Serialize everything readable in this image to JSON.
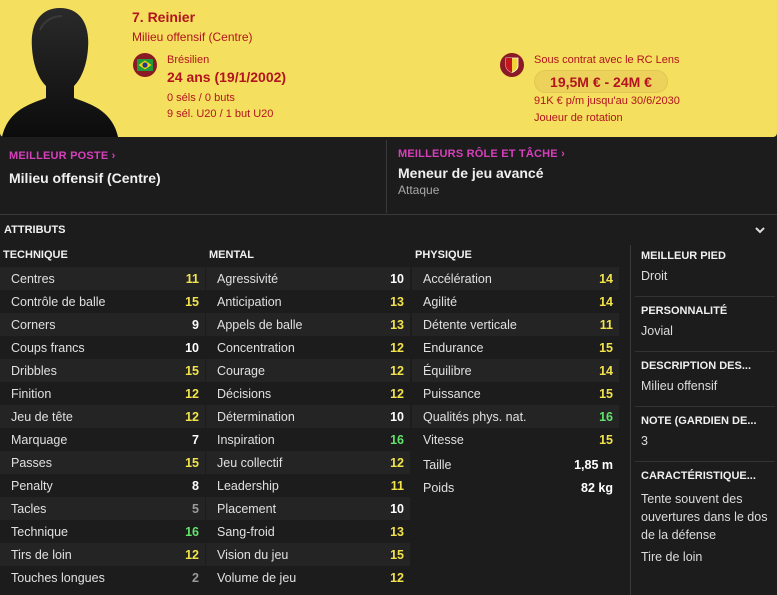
{
  "player": {
    "name": "7. Reinier",
    "position": "Milieu offensif (Centre)",
    "nationality": "Brésilien",
    "age": "24 ans (19/1/2002)",
    "stats_line1": "0 séls / 0 buts",
    "stats_line2": "9 sél. U20 / 1 but U20",
    "contract": "Sous contrat avec le RC Lens",
    "value": "19,5M € - 24M €",
    "wage": "91K € p/m jusqu'au 30/6/2030",
    "squad_status": "Joueur de rotation"
  },
  "best": {
    "position_label": "MEILLEUR POSTE",
    "position_value": "Milieu offensif (Centre)",
    "role_label": "MEILLEURS RÔLE ET TÂCHE",
    "role_value": "Meneur de jeu avancé",
    "role_duty": "Attaque"
  },
  "attributes_title": "ATTRIBUTS",
  "technical": {
    "title": "TECHNIQUE",
    "rows": [
      {
        "label": "Centres",
        "value": "11",
        "color": "yellow"
      },
      {
        "label": "Contrôle de balle",
        "value": "15",
        "color": "yellow"
      },
      {
        "label": "Corners",
        "value": "9",
        "color": "white"
      },
      {
        "label": "Coups francs",
        "value": "10",
        "color": "white"
      },
      {
        "label": "Dribbles",
        "value": "15",
        "color": "yellow"
      },
      {
        "label": "Finition",
        "value": "12",
        "color": "yellow"
      },
      {
        "label": "Jeu de tête",
        "value": "12",
        "color": "yellow"
      },
      {
        "label": "Marquage",
        "value": "7",
        "color": "white"
      },
      {
        "label": "Passes",
        "value": "15",
        "color": "yellow"
      },
      {
        "label": "Penalty",
        "value": "8",
        "color": "white"
      },
      {
        "label": "Tacles",
        "value": "5",
        "color": "grey"
      },
      {
        "label": "Technique",
        "value": "16",
        "color": "green"
      },
      {
        "label": "Tirs de loin",
        "value": "12",
        "color": "yellow"
      },
      {
        "label": "Touches longues",
        "value": "2",
        "color": "grey"
      }
    ]
  },
  "mental": {
    "title": "MENTAL",
    "rows": [
      {
        "label": "Agressivité",
        "value": "10",
        "color": "white"
      },
      {
        "label": "Anticipation",
        "value": "13",
        "color": "yellow"
      },
      {
        "label": "Appels de balle",
        "value": "13",
        "color": "yellow"
      },
      {
        "label": "Concentration",
        "value": "12",
        "color": "yellow"
      },
      {
        "label": "Courage",
        "value": "12",
        "color": "yellow"
      },
      {
        "label": "Décisions",
        "value": "12",
        "color": "yellow"
      },
      {
        "label": "Détermination",
        "value": "10",
        "color": "white"
      },
      {
        "label": "Inspiration",
        "value": "16",
        "color": "green"
      },
      {
        "label": "Jeu collectif",
        "value": "12",
        "color": "yellow"
      },
      {
        "label": "Leadership",
        "value": "11",
        "color": "yellow"
      },
      {
        "label": "Placement",
        "value": "10",
        "color": "white"
      },
      {
        "label": "Sang-froid",
        "value": "13",
        "color": "yellow"
      },
      {
        "label": "Vision du jeu",
        "value": "15",
        "color": "yellow"
      },
      {
        "label": "Volume de jeu",
        "value": "12",
        "color": "yellow"
      }
    ]
  },
  "physical": {
    "title": "PHYSIQUE",
    "rows": [
      {
        "label": "Accélération",
        "value": "14",
        "color": "yellow"
      },
      {
        "label": "Agilité",
        "value": "14",
        "color": "yellow"
      },
      {
        "label": "Détente verticale",
        "value": "11",
        "color": "yellow"
      },
      {
        "label": "Endurance",
        "value": "15",
        "color": "yellow"
      },
      {
        "label": "Équilibre",
        "value": "14",
        "color": "yellow"
      },
      {
        "label": "Puissance",
        "value": "15",
        "color": "yellow"
      },
      {
        "label": "Qualités phys. nat.",
        "value": "16",
        "color": "green"
      },
      {
        "label": "Vitesse",
        "value": "15",
        "color": "yellow"
      }
    ],
    "extra": [
      {
        "label": "Taille",
        "value": "1,85 m"
      },
      {
        "label": "Poids",
        "value": "82 kg"
      }
    ]
  },
  "side": {
    "foot_label": "MEILLEUR PIED",
    "foot_value": "Droit",
    "personality_label": "PERSONNALITÉ",
    "personality_value": "Jovial",
    "description_label": "DESCRIPTION DES...",
    "description_value": "Milieu offensif",
    "gk_label": "NOTE (GARDIEN DE...",
    "gk_value": "3",
    "traits_label": "CARACTÉRISTIQUE...",
    "trait1": "Tente souvent des ouvertures dans le dos de la défense",
    "trait2": "Tire de loin"
  },
  "colors": {
    "header_bg": "#f4df5e",
    "header_text": "#b3141f",
    "accent_pink": "#d83fbd",
    "value_yellow": "#f2e34c",
    "value_green": "#63e36b",
    "value_grey": "#9a9a9a"
  },
  "icons": {
    "flag": "brazil-flag-icon",
    "club": "rc-lens-crest-icon",
    "collapse": "chevron-down-icon",
    "link": "chevron-right-icon"
  }
}
